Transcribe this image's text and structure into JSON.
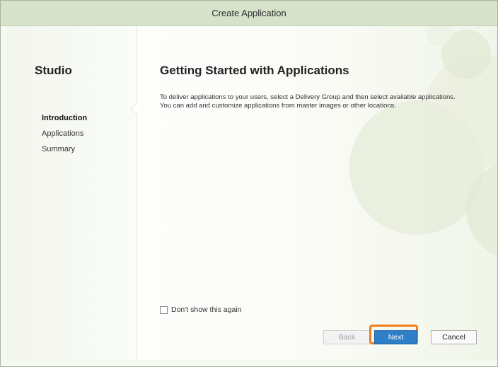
{
  "window": {
    "title": "Create Application"
  },
  "sidebar": {
    "brand": "Studio",
    "steps": [
      {
        "label": "Introduction",
        "active": true
      },
      {
        "label": "Applications",
        "active": false
      },
      {
        "label": "Summary",
        "active": false
      }
    ]
  },
  "main": {
    "title": "Getting Started with Applications",
    "description": "To deliver applications to your users, select a Delivery Group and then select available applications. You can add and customize applications from master images or other locations.",
    "dont_show_again": {
      "label": "Don't show this again",
      "checked": false
    }
  },
  "footer": {
    "back_label": "Back",
    "next_label": "Next",
    "cancel_label": "Cancel",
    "highlight_color": "#ef7d1a"
  },
  "colors": {
    "accent": "#2e7fc7",
    "titlebar": "#d6e2c9"
  }
}
